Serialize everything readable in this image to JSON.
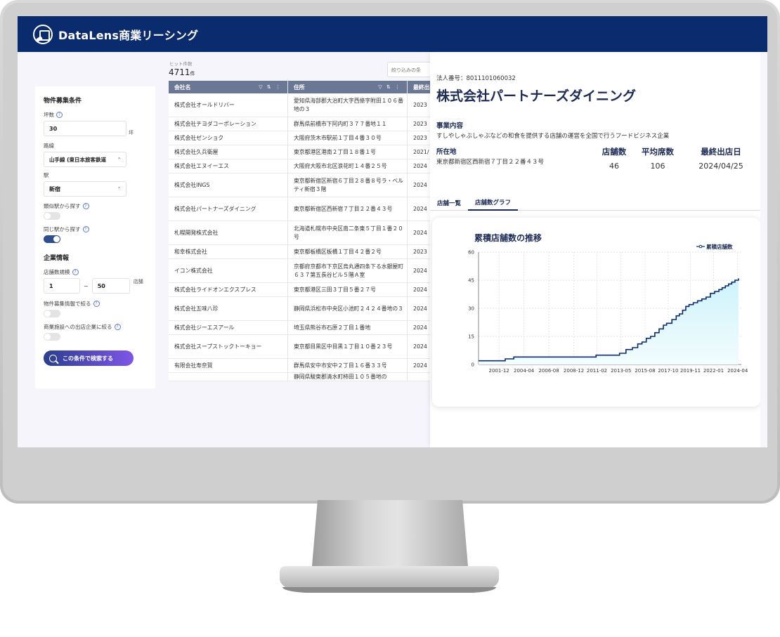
{
  "app": {
    "title": "DataLens商業リーシング"
  },
  "sidebar": {
    "property_section": "物件募集条件",
    "tsubo_label": "坪数",
    "tsubo_value": "30",
    "tsubo_unit": "坪",
    "line_label": "路線",
    "line_value": "山手線 (東日本旅客鉄道",
    "station_label": "駅",
    "station_value": "新宿",
    "similar_label": "類似駅から探す",
    "same_label": "同じ駅から探す",
    "company_section": "企業情報",
    "stores_label": "店舗数規模",
    "stores_min": "1",
    "stores_sep": "~",
    "stores_max": "50",
    "stores_unit": "店舗",
    "narrow_prop_label": "物件募集情報で絞る",
    "narrow_mall_label": "商業施設への出店企業に絞る",
    "search_button": "この条件で検索する"
  },
  "results": {
    "hits_label": "ヒット件数",
    "hits_count": "4711",
    "hits_unit": "件",
    "filter_placeholder": "絞り込みの条",
    "columns": [
      "会社名",
      "住所",
      "最終出"
    ],
    "rows": [
      {
        "name": "株式会社オールドリバー",
        "addr": "愛知県海部郡大治町大字西條字附田１０６番地の３",
        "date": "2023"
      },
      {
        "name": "株式会社チヨダコーポレーション",
        "addr": "群馬県前橋市下阿内町３７７番地１１",
        "date": "2023"
      },
      {
        "name": "株式会社ゼンショク",
        "addr": "大阪府茨木市駅前１丁目４番３０号",
        "date": "2023"
      },
      {
        "name": "株式会社久兵衛屋",
        "addr": "東京都港区港南２丁目１８番１号",
        "date": "2021/"
      },
      {
        "name": "株式会社エヌイーエス",
        "addr": "大阪府大阪市北区浪花町１４番２５号",
        "date": "2024"
      },
      {
        "name": "株式会社INGS",
        "addr": "東京都新宿区新宿６丁目２８番８号ラ・ベルティ新宿３階",
        "date": "2024"
      },
      {
        "name": "株式会社パートナーズダイニング",
        "addr": "東京都新宿区西新宿７丁目２２番４３号",
        "date": "2024"
      },
      {
        "name": "札幌開発株式会社",
        "addr": "北海道札幌市中央区南二条東５丁目１番２０号",
        "date": "2024"
      },
      {
        "name": "和幸株式会社",
        "addr": "東京都板橋区板橋１丁目４２番２号",
        "date": "2023"
      },
      {
        "name": "イコン株式会社",
        "addr": "京都府京都市下京区烏丸通四条下る水銀屋町６３７第五長谷ビル５階Ａ室",
        "date": "2024"
      },
      {
        "name": "株式会社ライドオンエクスプレス",
        "addr": "東京都港区三田３丁目５番２７号",
        "date": "2024"
      },
      {
        "name": "株式会社五味八珍",
        "addr": "静岡県浜松市中央区小池町２４２４番地の３",
        "date": "2024"
      },
      {
        "name": "株式会社ジーエスアール",
        "addr": "埼玉県熊谷市石原２丁目１番地",
        "date": "2024"
      },
      {
        "name": "株式会社スープストックトーキョー",
        "addr": "東京都目黒区中目黒１丁目１０番２３号",
        "date": "2024"
      },
      {
        "name": "有限会社寿奈賀",
        "addr": "群馬県安中市安中２丁目１６番３３号",
        "date": "2024"
      },
      {
        "name": "",
        "addr": "静岡県駿東郡清水町柿田１０５番地の",
        "date": ""
      }
    ]
  },
  "detail": {
    "corp_number": "法人番号：8011101060032",
    "name": "株式会社パートナーズダイニング",
    "business_label": "事業内容",
    "business_text": "すしやしゃぶしゃぶなどの和食を提供する店舗の運営を全国で行うフードビジネス企業",
    "location_label": "所在地",
    "location_text": "東京都新宿区西新宿７丁目２２番４３号",
    "stats": [
      {
        "label": "店舗数",
        "value": "46"
      },
      {
        "label": "平均席数",
        "value": "106"
      },
      {
        "label": "最終出店日",
        "value": "2024/04/25"
      }
    ],
    "tabs": [
      "店舗一覧",
      "店舗数グラフ"
    ]
  },
  "chart_data": {
    "type": "line",
    "title": "累積店舗数の推移",
    "xlabel": "",
    "ylabel": "",
    "ylim": [
      0,
      60
    ],
    "yticks": [
      0,
      15,
      30,
      45,
      60
    ],
    "xticks": [
      "2001-12",
      "2004-04",
      "2006-08",
      "2008-12",
      "2011-02",
      "2013-05",
      "2015-08",
      "2017-10",
      "2019-11",
      "2022-01",
      "2024-04"
    ],
    "grid": true,
    "legend_position": "top-right",
    "series": [
      {
        "name": "累積店舗数",
        "color": "#0b2b6f",
        "fill": "#cdf3fb",
        "x": [
          2000.0,
          2002.5,
          2003.3,
          2008.8,
          2011.0,
          2011.5,
          2013.2,
          2013.8,
          2014.4,
          2014.9,
          2015.3,
          2015.7,
          2016.1,
          2016.5,
          2016.9,
          2017.3,
          2017.6,
          2018.1,
          2018.5,
          2018.8,
          2019.1,
          2019.4,
          2019.7,
          2020.1,
          2020.5,
          2020.9,
          2021.3,
          2021.7,
          2022.1,
          2022.5,
          2022.8,
          2023.1,
          2023.4,
          2023.7,
          2024.0,
          2024.33
        ],
        "y": [
          2,
          3,
          4,
          4,
          5,
          5,
          6,
          8,
          9,
          11,
          12,
          14,
          15,
          17,
          19,
          21,
          22,
          24,
          26,
          27,
          29,
          31,
          32,
          33,
          34,
          35,
          36,
          38,
          39,
          40,
          41,
          42,
          43,
          44,
          45,
          46
        ]
      }
    ]
  }
}
